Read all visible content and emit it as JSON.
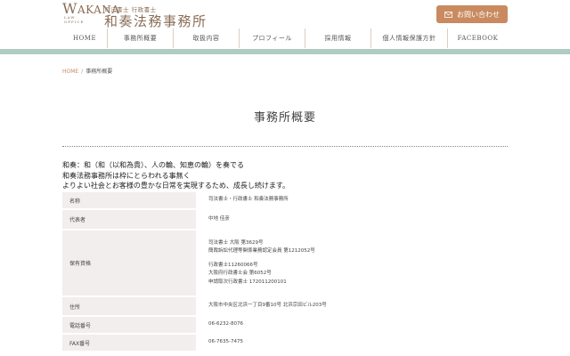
{
  "header": {
    "logo_letter": "W",
    "logo_letters_rest": "AKANA",
    "logo_sub": [
      "LAW",
      "OFFICE"
    ],
    "logo_tagline": "司法書士 行政書士",
    "logo_name": "和奏法務事務所",
    "contact_label": "お問い合わせ"
  },
  "nav": {
    "items": [
      {
        "label": "HOME"
      },
      {
        "label": "事務所概要"
      },
      {
        "label": "取扱内容"
      },
      {
        "label": "プロフィール"
      },
      {
        "label": "採用情報"
      },
      {
        "label": "個人情報保護方針"
      },
      {
        "label": "FACEBOOK"
      }
    ]
  },
  "breadcrumb": {
    "home": "HOME",
    "separator": "/",
    "current": "事務所概要"
  },
  "page_title": "事務所概要",
  "intro": [
    "和奏：和（和（以和為貴）、人の輪、知恵の輪）を奏でる",
    "和奏法務事務所は枠にとらわれる事無く",
    "よりよい社会とお客様の豊かな日常を実現するため、成長し続けます。"
  ],
  "table": {
    "rows": [
      {
        "label": "名称",
        "lines": [
          "司法書士・行政書士 和奏法務事務所"
        ]
      },
      {
        "label": "代表者",
        "lines": [
          "中地 佳彦"
        ]
      },
      {
        "label": "保有資格",
        "lines": [
          "司法書士 大阪 第3629号",
          "簡裁訴訟代理等関係業務認定会員 第1212052号",
          "",
          "行政書士11260066号",
          "大阪府行政書士会 第6052号",
          "申請取次行政書士 172011200101"
        ]
      },
      {
        "label": "住所",
        "lines": [
          "大阪市中央区北浜一丁目9番10号 北浜宗田ビル203号"
        ]
      },
      {
        "label": "電話番号",
        "lines": [
          "06-6232-8076"
        ]
      },
      {
        "label": "FAX番号",
        "lines": [
          "06-7635-7475"
        ]
      }
    ]
  },
  "colors": {
    "accent": "#c98a5f",
    "band": "#aeccc4",
    "logo": "#8a6d55",
    "table_header_bg": "#f1eeed"
  }
}
